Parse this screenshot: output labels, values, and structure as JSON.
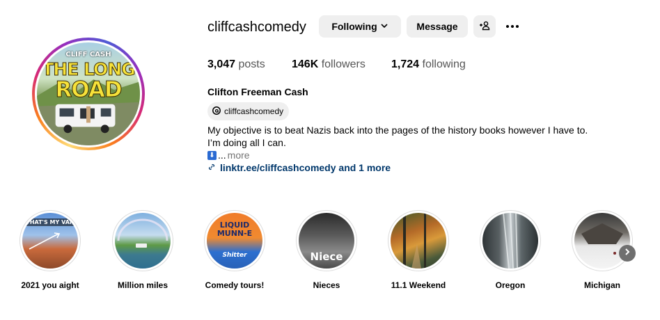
{
  "profile": {
    "username": "cliffcashcomedy",
    "full_name": "Clifton Freeman Cash",
    "avatar": {
      "small_text": "CLIFF CASH",
      "title_line1": "THE LONG",
      "title_line2": "ROAD"
    }
  },
  "actions": {
    "following_label": "Following",
    "message_label": "Message",
    "add_user_icon": "add-user-icon",
    "more_icon": "more-icon"
  },
  "stats": {
    "posts_count": "3,047",
    "posts_label": "posts",
    "followers_count": "146K",
    "followers_label": "followers",
    "following_count": "1,724",
    "following_label": "following"
  },
  "bio": {
    "threads_handle": "cliffcashcomedy",
    "line1": "My objective is to beat Nazis back into the pages of the history books however I have to.",
    "line2": "I’m doing all I can.",
    "emoji": "⬇",
    "ellipsis": "... ",
    "more": "more",
    "link_text": "linktr.ee/cliffcashcomedy and 1 more"
  },
  "highlights": [
    {
      "label": "2021 you aight",
      "caption": "THAT'S MY VAN"
    },
    {
      "label": "Million miles",
      "caption": ""
    },
    {
      "label": "Comedy tours!",
      "caption": "LIQUID MUNN-E",
      "caption2": "Shitter"
    },
    {
      "label": "Nieces",
      "caption": "Niece"
    },
    {
      "label": "11.1 Weekend",
      "caption": ""
    },
    {
      "label": "Oregon",
      "caption": ""
    },
    {
      "label": "Michigan",
      "caption": ""
    }
  ],
  "colors": {
    "button_bg": "#efefef",
    "link": "#00376b",
    "muted": "#737373"
  }
}
